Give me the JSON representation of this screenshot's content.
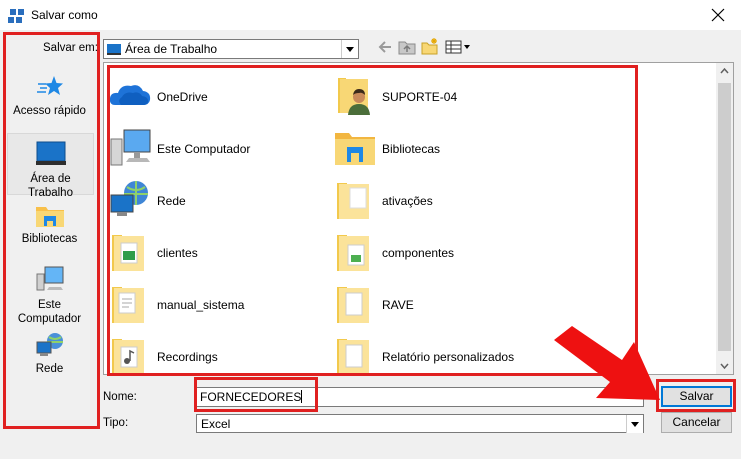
{
  "window": {
    "title": "Salvar como"
  },
  "location": {
    "label": "Salvar em:",
    "value": "Área de Trabalho"
  },
  "places": [
    {
      "label": "Acesso rápido",
      "icon": "star-icon"
    },
    {
      "label": "Área de Trabalho",
      "icon": "desktop-icon"
    },
    {
      "label": "Bibliotecas",
      "icon": "libraries-icon"
    },
    {
      "label": "Este Computador",
      "icon": "computer-icon"
    },
    {
      "label": "Rede",
      "icon": "network-icon"
    }
  ],
  "files": [
    {
      "name": "OneDrive",
      "icon": "onedrive-icon"
    },
    {
      "name": "SUPORTE-04",
      "icon": "user-folder-icon"
    },
    {
      "name": "Este Computador",
      "icon": "computer-icon"
    },
    {
      "name": "Bibliotecas",
      "icon": "libraries-icon"
    },
    {
      "name": "Rede",
      "icon": "network-icon"
    },
    {
      "name": "ativações",
      "icon": "folder-icon"
    },
    {
      "name": "clientes",
      "icon": "folder-icon"
    },
    {
      "name": "componentes",
      "icon": "folder-icon"
    },
    {
      "name": "manual_sistema",
      "icon": "folder-icon"
    },
    {
      "name": "RAVE",
      "icon": "folder-icon"
    },
    {
      "name": "Recordings",
      "icon": "folder-icon"
    },
    {
      "name": "Relatório personalizados",
      "icon": "folder-icon"
    }
  ],
  "filename": {
    "label": "Nome:",
    "value": "FORNECEDORES"
  },
  "filetype": {
    "label": "Tipo:",
    "value": "Excel"
  },
  "buttons": {
    "save": "Salvar",
    "cancel": "Cancelar"
  },
  "colors": {
    "highlight": "#e02020",
    "accent": "#0078d7",
    "folder": "#f8d775"
  }
}
